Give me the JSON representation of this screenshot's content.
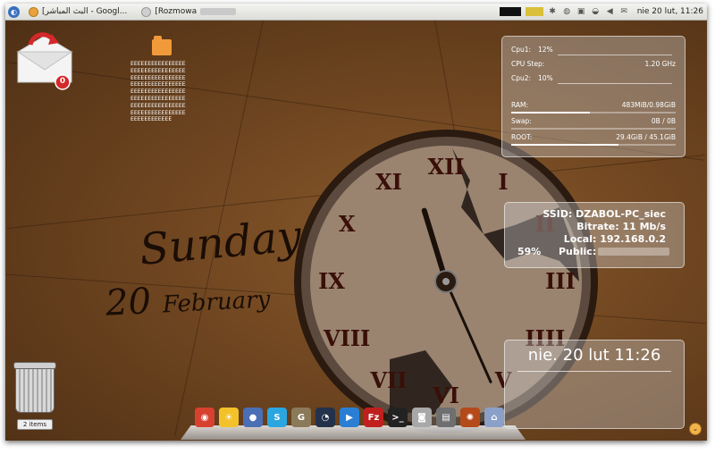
{
  "panel": {
    "tasks": [
      {
        "label": "[البث المباشر - Googl..."
      },
      {
        "label": "[Rozmowa"
      }
    ],
    "clock": "nie 20 lut, 11:26"
  },
  "desktop": {
    "mail_badge": "0",
    "folder_lines": [
      "EEEEEEEEEEEEEEEE",
      "EEEEEEEEEEEEEEEE",
      "EEEEEEEEEEEEEEEE",
      "EEEEEEEEEEEEEEEE",
      "EEEEEEEEEEEEEEEE",
      "EEEEEEEEEEEEEEEE",
      "EEEEEEEEEEEEEEEE",
      "EEEEEEEEEEEEEEEE",
      "EEEEEEEEEEEE"
    ],
    "day": "Sunday",
    "date_num": "20",
    "date_month": "February",
    "trash_label": "2 items"
  },
  "sysmon": {
    "cpu1_label": "Cpu1:",
    "cpu1_value": "12%",
    "cpustep_label": "CPU Step:",
    "cpustep_value": "1.20 GHz",
    "cpu2_label": "Cpu2:",
    "cpu2_value": "10%",
    "ram_label": "RAM:",
    "ram_value": "483MiB/0.98GiB",
    "ram_fraction": 0.48,
    "swap_label": "Swap:",
    "swap_value": "0B   / 0B",
    "swap_fraction": 0.0,
    "root_label": "ROOT:",
    "root_value": "29.4GiB / 45.1GiB",
    "root_fraction": 0.65
  },
  "network": {
    "ssid": "SSID: DZABOL-PC_siec",
    "bitrate": "Bitrate: 11 Mb/s",
    "local": "Local: 192.168.0.2",
    "signal": "59%",
    "public_label": "Public:"
  },
  "clockwidget": {
    "time": "nie. 20 lut 11:26"
  },
  "clock": {
    "numerals": [
      "XII",
      "I",
      "II",
      "III",
      "IIII",
      "V",
      "VI",
      "VII",
      "VIII",
      "IX",
      "X",
      "XI"
    ],
    "hour": 11,
    "minute": 26
  },
  "dock": {
    "items": [
      {
        "name": "chrome-icon",
        "color": "#d8412f",
        "glyph": "◉"
      },
      {
        "name": "sun-weather-icon",
        "color": "#f3c22b",
        "glyph": "☀"
      },
      {
        "name": "pidgin-icon",
        "color": "#4a6fb5",
        "glyph": "●"
      },
      {
        "name": "skype-icon",
        "color": "#2ba6e0",
        "glyph": "S"
      },
      {
        "name": "gimp-icon",
        "color": "#8a7a5a",
        "glyph": "G"
      },
      {
        "name": "vlc-icon",
        "color": "#23324a",
        "glyph": "◔"
      },
      {
        "name": "player-icon",
        "color": "#2a7fd4",
        "glyph": "▶"
      },
      {
        "name": "filezilla-icon",
        "color": "#c0201d",
        "glyph": "Fz"
      },
      {
        "name": "terminal-icon",
        "color": "#222222",
        "glyph": ">_"
      },
      {
        "name": "camera-icon",
        "color": "#a8a8a8",
        "glyph": "◙"
      },
      {
        "name": "scanner-icon",
        "color": "#6f6f6f",
        "glyph": "▤"
      },
      {
        "name": "ubuntu-icon",
        "color": "#b44a1a",
        "glyph": "✺"
      },
      {
        "name": "home-folder-icon",
        "color": "#8aa0c8",
        "glyph": "⌂"
      }
    ]
  }
}
